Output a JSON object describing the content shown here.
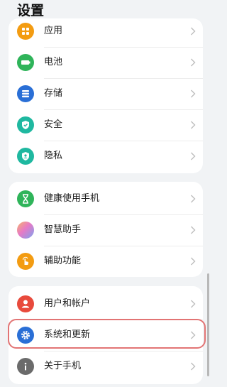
{
  "page": {
    "title": "设置"
  },
  "group1": {
    "items": [
      {
        "label": "应用",
        "icon": "apps-icon",
        "color": "#f39c12"
      },
      {
        "label": "电池",
        "icon": "battery-icon",
        "color": "#2fb45a"
      },
      {
        "label": "存储",
        "icon": "storage-icon",
        "color": "#2a6fd6"
      },
      {
        "label": "安全",
        "icon": "shield-icon",
        "color": "#1fb8a0"
      },
      {
        "label": "隐私",
        "icon": "privacy-icon",
        "color": "#1fb8a0"
      }
    ]
  },
  "group2": {
    "items": [
      {
        "label": "健康使用手机",
        "icon": "hourglass-icon",
        "color": "#2fb45a"
      },
      {
        "label": "智慧助手",
        "icon": "assistant-icon",
        "color": "#c56bd6"
      },
      {
        "label": "辅助功能",
        "icon": "hand-icon",
        "color": "#f39c12"
      }
    ]
  },
  "group3": {
    "items": [
      {
        "label": "用户和帐户",
        "icon": "user-icon",
        "color": "#e84a3c"
      },
      {
        "label": "系统和更新",
        "icon": "gear-icon",
        "color": "#2a6fd6"
      },
      {
        "label": "关于手机",
        "icon": "info-icon",
        "color": "#6b6b6b"
      }
    ]
  },
  "highlighted_item": "系统和更新"
}
